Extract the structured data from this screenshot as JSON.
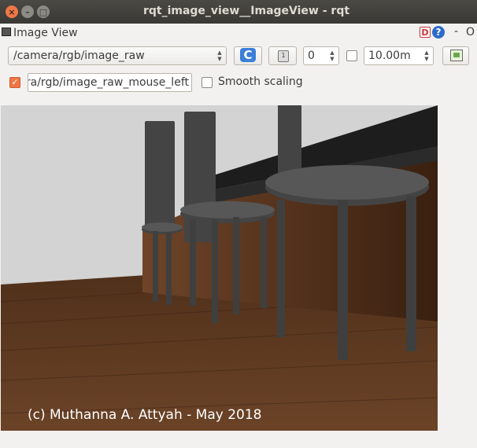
{
  "window": {
    "title": "rqt_image_view__ImageView - rqt",
    "close_glyph": "×",
    "minimize_glyph": "–",
    "maximize_glyph": "□"
  },
  "dock": {
    "title": "Image View",
    "d_label": "D",
    "help_label": "?",
    "minimize_label": "-",
    "close_label": "O"
  },
  "toolbar": {
    "topic": "/camera/rgb/image_raw",
    "rotation_value": "0",
    "rotate_icon_glyph": "1",
    "refresh_icon_glyph": "C",
    "max_fps_value": "10.00m",
    "max_fps_checked": false
  },
  "publish": {
    "checked": true,
    "check_glyph": "✓",
    "topic": "/camera/rgb/image_raw_mouse_left"
  },
  "smooth_scaling": {
    "label": "Smooth scaling",
    "checked": false
  },
  "image": {
    "caption": "(c) Muthanna A. Attyah - May 2018",
    "colors": {
      "floor": "#5e3a22",
      "wall": "#4a2a16",
      "background": "#d3d3d3",
      "stool": "#4a4a4a"
    }
  }
}
